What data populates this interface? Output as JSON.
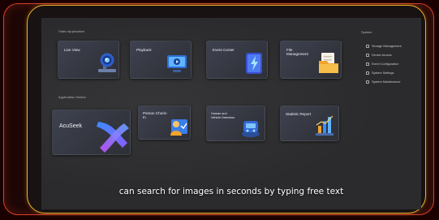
{
  "colors": {
    "outer_frame": "#d8402a",
    "inner_frame": "#f0b22a",
    "screen_background": "#2b2b2d",
    "tile_background": "#3a3d48",
    "accent_blue": "#3b8cff",
    "accent_purple": "#8a5cff",
    "accent_orange": "#f3a32b"
  },
  "sections": {
    "video_application": "Video Application",
    "application_series": "Application Series",
    "system": "System"
  },
  "tiles": [
    {
      "label": "Live View",
      "icon": "camera-icon"
    },
    {
      "label": "Playback",
      "icon": "playback-monitor-icon"
    },
    {
      "label": "Event Center",
      "icon": "event-lightning-icon"
    },
    {
      "label": "File Management",
      "icon": "file-folder-icon"
    },
    {
      "label": "AcuSeek",
      "icon": "acuseek-logo-icon"
    },
    {
      "label": "Person Check-In",
      "icon": "person-check-in-icon"
    },
    {
      "label": "Human and Vehicle Detection",
      "icon": "detection-icon"
    },
    {
      "label": "Statistic Report",
      "icon": "bar-chart-icon"
    }
  ],
  "system_menu": [
    {
      "label": "Storage Management",
      "icon": "storage-icon"
    },
    {
      "label": "Device Access",
      "icon": "device-icon"
    },
    {
      "label": "Event Configuration",
      "icon": "event-config-icon"
    },
    {
      "label": "System Settings",
      "icon": "settings-icon"
    },
    {
      "label": "System Maintenance",
      "icon": "maintenance-icon"
    }
  ],
  "caption": "can search for images in seconds by typing free text"
}
